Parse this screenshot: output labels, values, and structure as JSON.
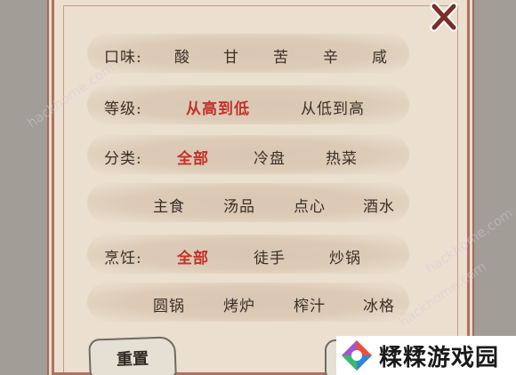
{
  "filters": {
    "taste": {
      "label": "口味:",
      "options": [
        "酸",
        "甘",
        "苦",
        "辛",
        "咸"
      ]
    },
    "level": {
      "label": "等级:",
      "options": [
        "从高到低",
        "从低到高"
      ]
    },
    "category": {
      "label": "分类:",
      "options": [
        "全部",
        "冷盘",
        "热菜",
        "主食",
        "汤品",
        "点心",
        "酒水"
      ]
    },
    "cooking": {
      "label": "烹饪:",
      "options": [
        "全部",
        "徒手",
        "炒锅",
        "圆锅",
        "烤炉",
        "榨汁",
        "冰格"
      ]
    }
  },
  "buttons": {
    "reset_label": "重置"
  },
  "logo": {
    "text": "糅糅游戏园"
  },
  "watermark": {
    "text": "hackhome.com"
  },
  "colors": {
    "active_option": "#c4312a",
    "text": "#3b2f28",
    "panel": "#ebdfcf",
    "border": "#b07160"
  },
  "icons": {
    "close": "close-x-icon",
    "logo": "logo-mark-icon"
  }
}
